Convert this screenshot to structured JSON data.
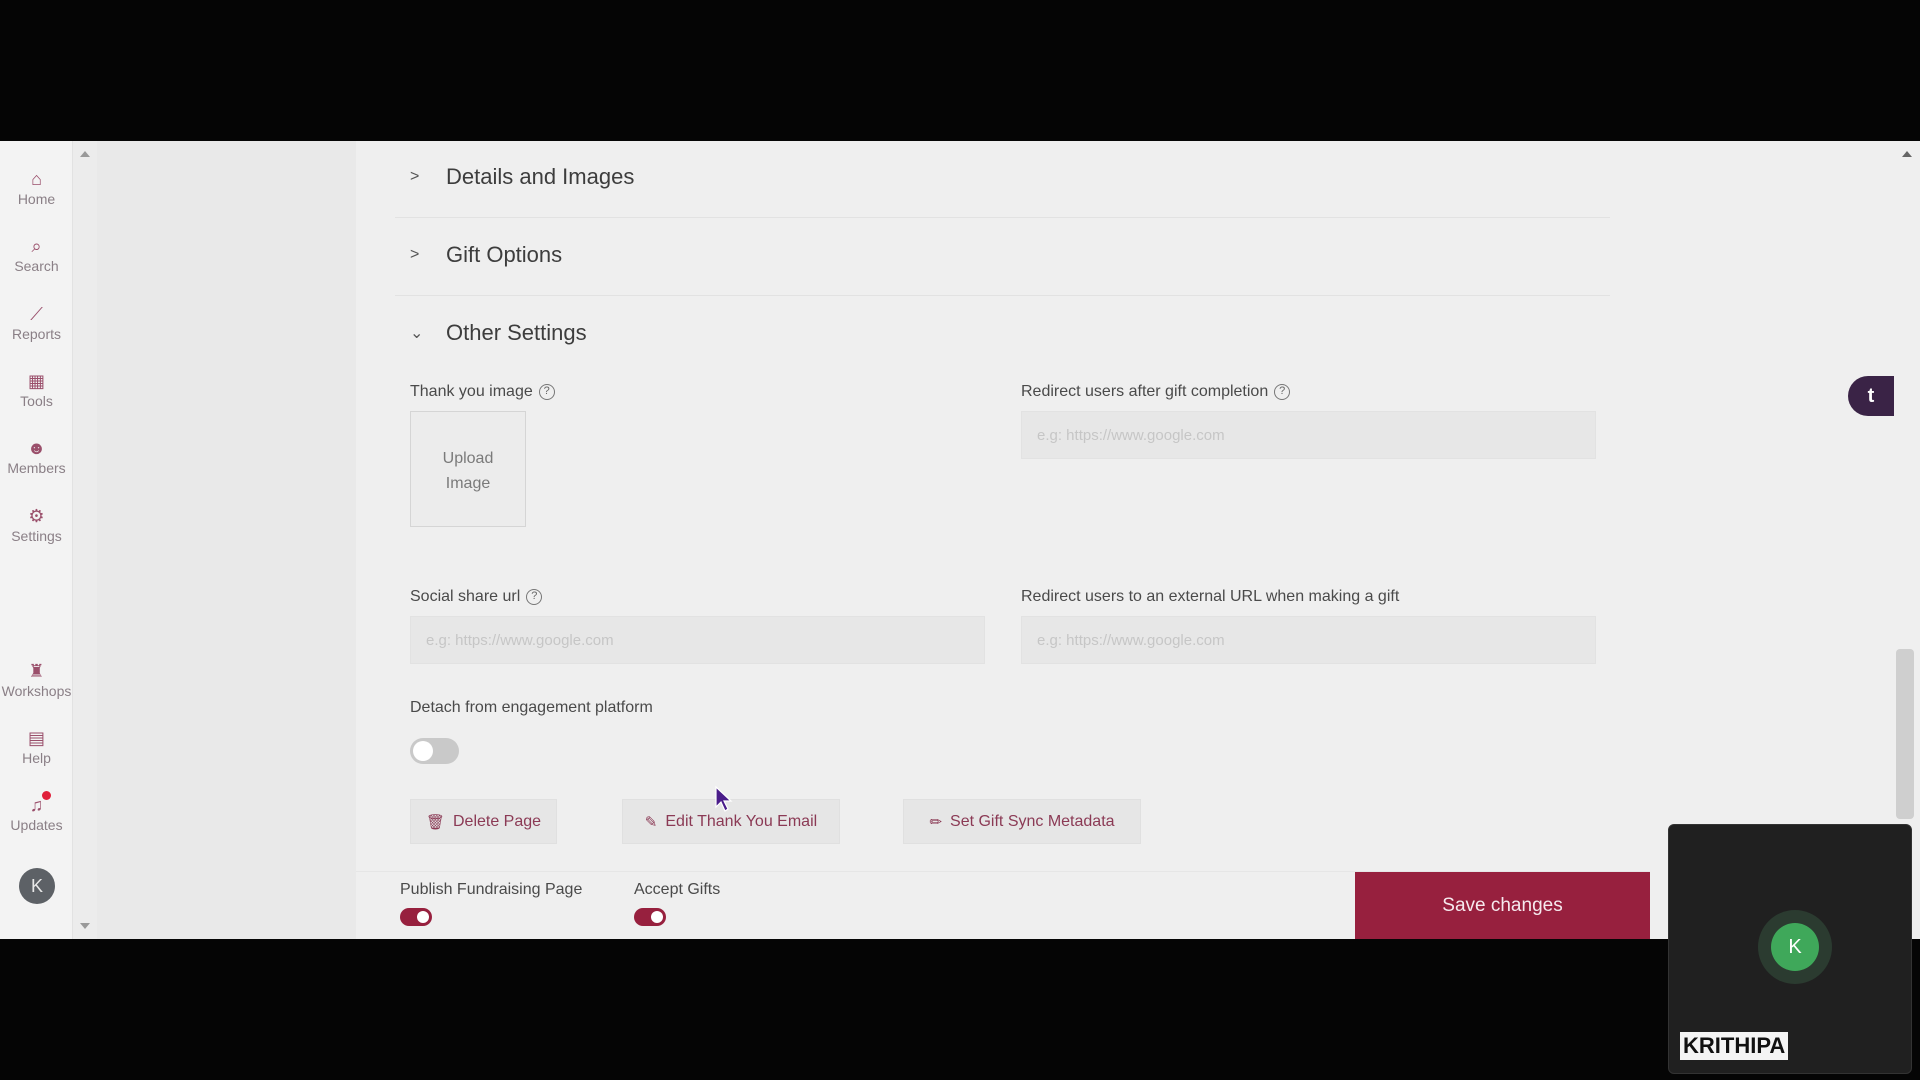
{
  "nav": {
    "items": [
      {
        "label": "Home",
        "icon": "home-icon",
        "glyph": "⌂"
      },
      {
        "label": "Search",
        "icon": "search-icon",
        "glyph": "⌕"
      },
      {
        "label": "Reports",
        "icon": "chart-icon",
        "glyph": "⟋"
      },
      {
        "label": "Tools",
        "icon": "grid-icon",
        "glyph": "▦"
      },
      {
        "label": "Members",
        "icon": "members-icon",
        "glyph": "☻"
      },
      {
        "label": "Settings",
        "icon": "gear-icon",
        "glyph": "⚙"
      },
      {
        "label": "Workshops",
        "icon": "workshop-icon",
        "glyph": "♜"
      },
      {
        "label": "Help",
        "icon": "book-icon",
        "glyph": "▤"
      },
      {
        "label": "Updates",
        "icon": "bell-icon",
        "glyph": "♫"
      }
    ],
    "avatar_initial": "K"
  },
  "sections": {
    "details": "Details and Images",
    "gift_options": "Gift Options",
    "other_settings": "Other Settings"
  },
  "fields": {
    "thank_you_image": "Thank you image",
    "upload_line1": "Upload",
    "upload_line2": "Image",
    "redirect_after_gift": "Redirect users after gift completion",
    "redirect_after_gift_placeholder": "e.g: https://www.google.com",
    "social_share_url": "Social share url",
    "social_share_placeholder": "e.g: https://www.google.com",
    "redirect_external": "Redirect users to an external URL when making a gift",
    "redirect_external_placeholder": "e.g: https://www.google.com",
    "detach_label": "Detach from engagement platform"
  },
  "buttons": {
    "delete_page": "Delete Page",
    "edit_thank_you_email": "Edit Thank You Email",
    "set_gift_sync_metadata": "Set Gift Sync Metadata",
    "save_changes": "Save changes"
  },
  "footer": {
    "publish_label": "Publish Fundraising Page",
    "accept_label": "Accept Gifts"
  },
  "floating_widget": "t",
  "participant": {
    "initial": "K",
    "name": "KRITHIPA"
  },
  "colors": {
    "accent": "#97203e",
    "nav_icon": "#9a4f6b"
  }
}
